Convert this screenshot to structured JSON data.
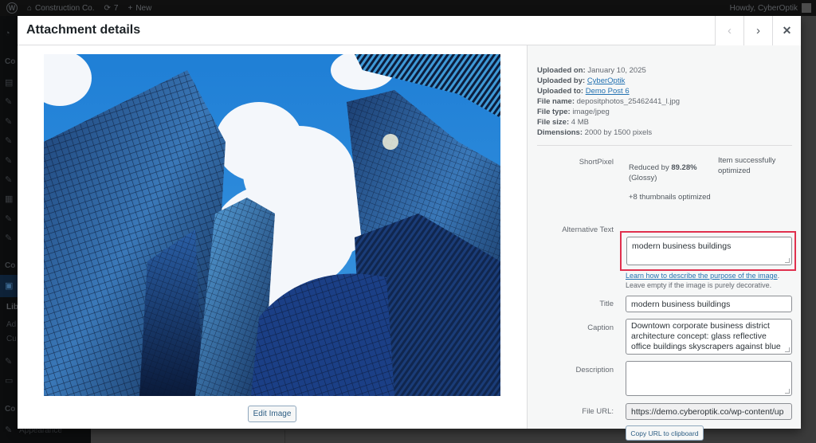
{
  "adminbar": {
    "site_name": "Construction Co.",
    "updates_count": "7",
    "new_label": "New",
    "greeting": "Howdy, CyberOptik"
  },
  "sidebar": {
    "headings": [
      "Co",
      "Co",
      "Co"
    ],
    "sub_items": [
      "Lib",
      "Ad",
      "Cu"
    ],
    "appearance_label": "Appearance"
  },
  "modal": {
    "title": "Attachment details",
    "prev_icon": "chevron-left-icon",
    "next_icon": "chevron-right-icon",
    "close_icon": "close-icon",
    "edit_image_label": "Edit Image"
  },
  "details": {
    "uploaded_on_label": "Uploaded on:",
    "uploaded_on": "January 10, 2025",
    "uploaded_by_label": "Uploaded by:",
    "uploaded_by": "CyberOptik",
    "uploaded_to_label": "Uploaded to:",
    "uploaded_to": "Demo Post 6",
    "file_name_label": "File name:",
    "file_name": "depositphotos_25462441_l.jpg",
    "file_type_label": "File type:",
    "file_type": "image/jpeg",
    "file_size_label": "File size:",
    "file_size": "4 MB",
    "dimensions_label": "Dimensions:",
    "dimensions": "2000 by 1500 pixels"
  },
  "shortpixel": {
    "label": "ShortPixel",
    "reduced_prefix": "Reduced by",
    "reduced_value": "89.28%",
    "mode": "(Glossy)",
    "thumbnails": "+8 thumbnails optimized",
    "status": "Item successfully optimized"
  },
  "form": {
    "alt_label": "Alternative Text",
    "alt_value": "modern business buildings",
    "alt_help_link": "Learn how to describe the purpose of the image",
    "alt_help_suffix": ".",
    "alt_help_text": "Leave empty if the image is purely decorative.",
    "title_label": "Title",
    "title_value": "modern business buildings",
    "caption_label": "Caption",
    "caption_value": "Downtown corporate business district architecture concept: glass reflective office buildings skyscrapers against blue",
    "description_label": "Description",
    "description_value": "",
    "file_url_label": "File URL:",
    "file_url_value": "https://demo.cyberoptik.co/wp-content/up",
    "copy_url_label": "Copy URL to clipboard"
  },
  "colors": {
    "highlight": "#e0304e",
    "link": "#2271b1"
  }
}
